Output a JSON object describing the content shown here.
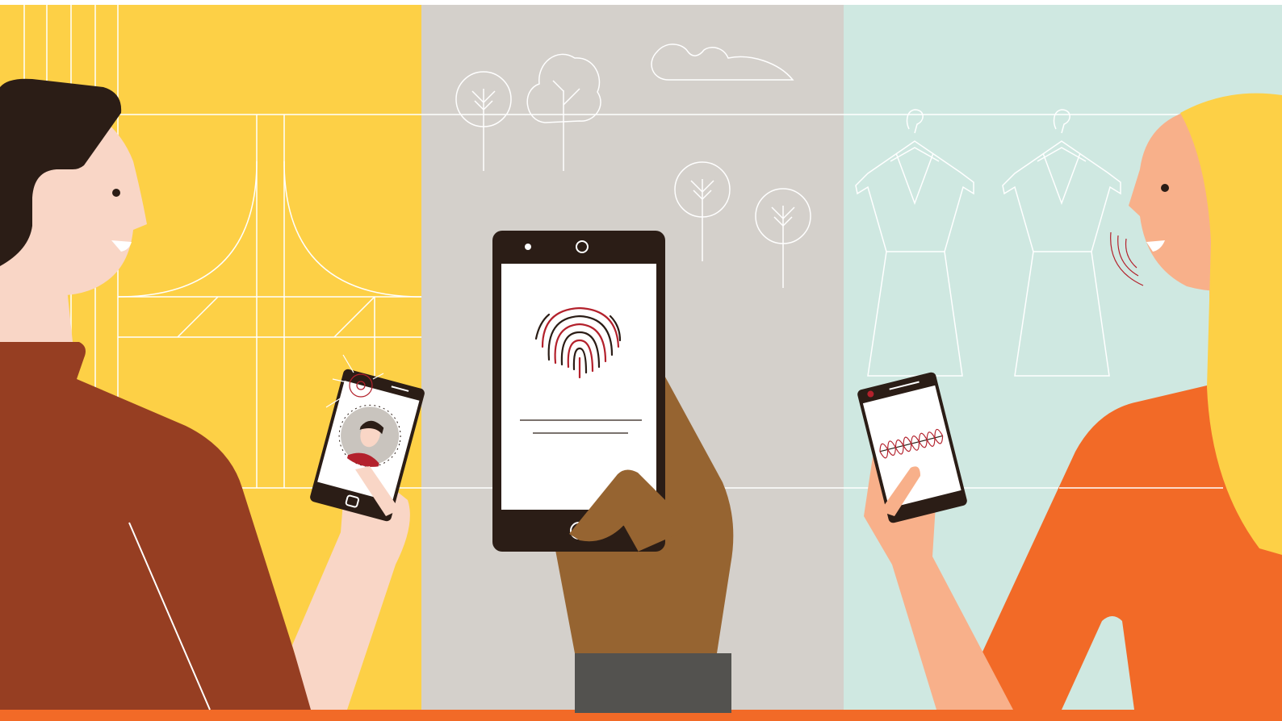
{
  "illustration": {
    "panels": [
      {
        "name": "face-recognition",
        "background": "#FDD046"
      },
      {
        "name": "fingerprint",
        "background": "#D4D0CB"
      },
      {
        "name": "voice-recognition",
        "background": "#CFE8E1"
      }
    ],
    "colors": {
      "skin_light": "#F9D6C6",
      "skin_peach": "#F8B08A",
      "skin_dark": "#966431",
      "hair_dark": "#2B1D16",
      "hair_blonde": "#FDD046",
      "shirt_rust": "#963E22",
      "shirt_orange": "#F26A27",
      "sleeve_gray": "#53524F",
      "phone_body": "#2B1D16",
      "accent_red": "#B3212C",
      "line_white": "#FFFFFF",
      "bottom_stripe": "#F26A27"
    },
    "icons": [
      "face-scan-icon",
      "fingerprint-icon",
      "voice-wave-icon",
      "tree-icon",
      "cloud-icon",
      "dress-icon",
      "hanger-icon"
    ]
  }
}
